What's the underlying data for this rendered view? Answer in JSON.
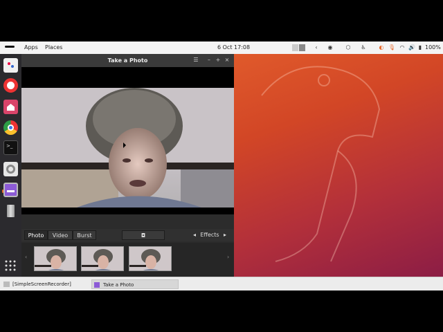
{
  "top_panel": {
    "apps_label": "Apps",
    "places_label": "Places",
    "clock": "6 Oct  17:08",
    "battery_percent": "100%"
  },
  "window": {
    "title": "Take a Photo"
  },
  "modes": {
    "photo": "Photo",
    "video": "Video",
    "burst": "Burst"
  },
  "effects_label": "Effects",
  "taskbar": {
    "items": [
      {
        "label": "[SimpleScreenRecorder]"
      },
      {
        "label": "Take a Photo"
      }
    ]
  },
  "colors": {
    "accent": "#e96b2d",
    "wallpaper_top": "#e05a2b",
    "wallpaper_bottom": "#8c1d45",
    "panel_bg": "#f4f4f4",
    "dock_bg": "#2b2a2e"
  }
}
